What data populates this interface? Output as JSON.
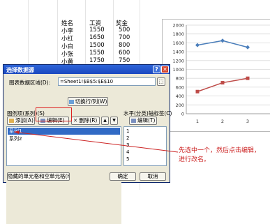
{
  "sheet": {
    "headers": [
      "姓名",
      "工资",
      "奖金"
    ],
    "rows": [
      [
        "小李",
        "1550",
        "500"
      ],
      [
        "小红",
        "1650",
        "700"
      ],
      [
        "小白",
        "1500",
        "800"
      ],
      [
        "小张",
        "1550",
        "600"
      ],
      [
        "小黄",
        "1750",
        "750"
      ]
    ]
  },
  "chart_data": {
    "type": "line",
    "x": [
      "1",
      "2",
      "3"
    ],
    "series": [
      {
        "values": [
          1550,
          1650,
          1500
        ],
        "color": "#4a7ebb"
      },
      {
        "values": [
          500,
          700,
          800
        ],
        "color": "#be4b48"
      }
    ],
    "ylim": [
      0,
      2000
    ],
    "yticks": [
      "2000",
      "1800",
      "1600",
      "1400",
      "1200",
      "1000",
      "800",
      "600",
      "400",
      "200",
      "0"
    ],
    "grid": true
  },
  "dialog": {
    "title": "选择数据源",
    "help_button": "?",
    "close_button": "✕",
    "range_label": "图表数据区域(D):",
    "range_value": "=Sheet1!$B$5:$E$10",
    "switch_button": "切换行/列(W)",
    "series_label": "图例项(系列)(S)",
    "add_button": "添加(A)",
    "edit_button": "编辑(E)",
    "delete_button": "删除(R)",
    "up_button": "▲",
    "down_button": "▼",
    "series_items": [
      "系列1",
      "系列2"
    ],
    "axis_label": "水平(分类)轴标签(C)",
    "axis_edit_button": "编辑(T)",
    "axis_items": [
      "1",
      "2",
      "3",
      "4",
      "5"
    ],
    "hidden_cells_button": "隐藏的单元格和空单元格(H)",
    "ok_button": "确定",
    "cancel_button": "取消"
  },
  "annotation": {
    "text": "先选中一个，然后点击编辑，进行改名。",
    "color": "#cc2222"
  }
}
